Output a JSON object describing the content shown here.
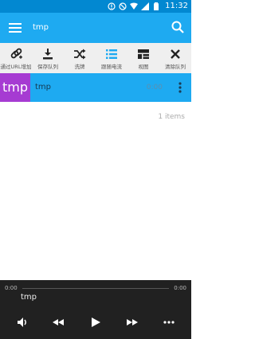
{
  "status_bar": {
    "time": "11:32"
  },
  "app_bar": {
    "title": "tmp"
  },
  "toolbar": {
    "items": [
      {
        "label": "通过URL增加",
        "icon": "link-add-icon"
      },
      {
        "label": "保存队列",
        "icon": "save-download-icon"
      },
      {
        "label": "洗牌",
        "icon": "shuffle-icon"
      },
      {
        "label": "跟随电流",
        "icon": "follow-list-icon"
      },
      {
        "label": "视图",
        "icon": "view-grid-icon"
      },
      {
        "label": "清除队列",
        "icon": "close-icon"
      }
    ]
  },
  "track": {
    "thumb_text": "tmp",
    "name": "tmp",
    "duration": "0:00"
  },
  "items_count": "1 items",
  "player": {
    "current_time": "0:00",
    "total_time": "0:00",
    "track_name": "tmp"
  },
  "colors": {
    "accent": "#1eaaf1",
    "status_bar": "#0288d1",
    "thumb": "#a63bd2",
    "player_bg": "#212121"
  }
}
